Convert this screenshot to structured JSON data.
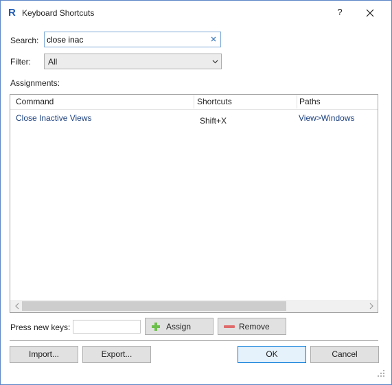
{
  "window": {
    "title": "Keyboard Shortcuts",
    "app_icon_letter": "R",
    "help_label": "?"
  },
  "search": {
    "label": "Search:",
    "value": "close inac"
  },
  "filter": {
    "label": "Filter:",
    "selected": "All"
  },
  "assignments": {
    "label": "Assignments:",
    "columns": [
      "Command",
      "Shortcuts",
      "Paths"
    ],
    "rows": [
      {
        "command": "Close Inactive Views",
        "shortcuts": "Shift+X",
        "paths": "View>Windows"
      }
    ]
  },
  "press_keys": {
    "label": "Press new keys:",
    "value": ""
  },
  "buttons": {
    "assign": "Assign",
    "remove": "Remove",
    "import": "Import...",
    "export": "Export...",
    "ok": "OK",
    "cancel": "Cancel"
  },
  "colors": {
    "accent": "#0078d7",
    "link_text": "#1a3f7e",
    "assign_icon": "#6cbf4a",
    "remove_icon": "#e06b6b"
  },
  "icons": {
    "app": "revit-r-icon",
    "close": "close-icon",
    "clear": "clear-x-icon",
    "chevron": "chevron-down-icon",
    "assign": "plus-icon",
    "remove": "minus-icon"
  }
}
